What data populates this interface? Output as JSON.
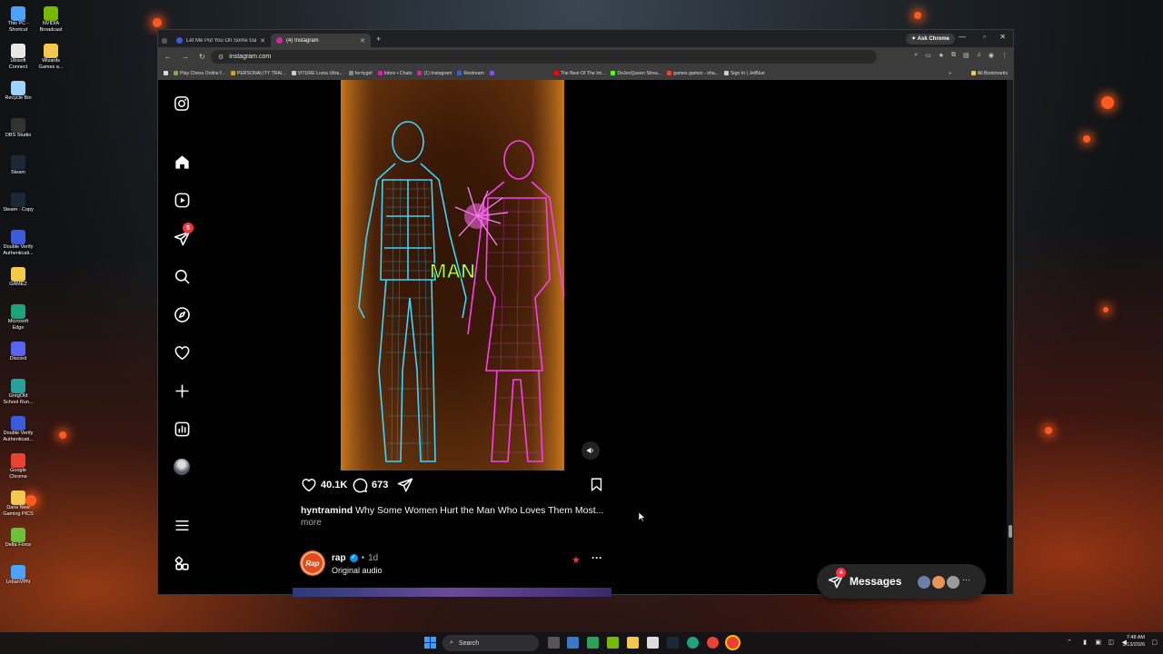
{
  "desktop": {
    "icons_col1": [
      {
        "label": "This PC - Shortcut",
        "icon": "pc-icon",
        "color": "#4aa3ff"
      },
      {
        "label": "Ubisoft Connect",
        "icon": "ubisoft-icon",
        "color": "#e8e8e8"
      },
      {
        "label": "Recycle Bin",
        "icon": "recycle-bin-icon",
        "color": "#9fd3ff"
      },
      {
        "label": "OBS Studio",
        "icon": "obs-icon",
        "color": "#333"
      },
      {
        "label": "Steam",
        "icon": "steam-icon",
        "color": "#1b2838"
      },
      {
        "label": "Steam - Copy",
        "icon": "steam-icon",
        "color": "#1b2838"
      },
      {
        "label": "Double Verify Authenticati...",
        "icon": "authenticator-icon",
        "color": "#3b5bdb"
      },
      {
        "label": "GAMEZ",
        "icon": "folder-icon",
        "color": "#f2c94c"
      },
      {
        "label": "Microsoft Edge",
        "icon": "edge-icon",
        "color": "#1fa37a"
      },
      {
        "label": "Discord",
        "icon": "discord-icon",
        "color": "#5865f2"
      },
      {
        "label": "GregOld School Run...",
        "icon": "game-icon",
        "color": "#2aa198"
      },
      {
        "label": "Double Verify Authenticati...",
        "icon": "authenticator-icon",
        "color": "#3b5bdb"
      },
      {
        "label": "Google Chrome",
        "icon": "chrome-icon",
        "color": "#e94235"
      },
      {
        "label": "Dans New Gaming PICS",
        "icon": "folder-icon",
        "color": "#f2c94c"
      },
      {
        "label": "Delta Force",
        "icon": "game-icon",
        "color": "#6fbf3f"
      },
      {
        "label": "UrbanVPN",
        "icon": "vpn-icon",
        "color": "#4aa3ff"
      }
    ],
    "icons_col2": [
      {
        "label": "NVIDIA Broadcast",
        "icon": "nvidia-icon",
        "color": "#76b900"
      },
      {
        "label": "Wizards Games a...",
        "icon": "folder-icon",
        "color": "#f2c94c"
      }
    ]
  },
  "browser": {
    "tabs": [
      {
        "title": "Let Me Put You On Some Gam...",
        "active": false,
        "favicon_color": "#3b5bdb"
      },
      {
        "title": "(4) Instagram",
        "active": true,
        "favicon_color": "#d6249f"
      }
    ],
    "new_tab": "+",
    "ask_chrome": "Ask Chrome",
    "url": "instagram.com",
    "bookmarks": [
      {
        "label": "Play Chess Online f...",
        "color": "#7fa650"
      },
      {
        "label": "PERSONALITY TRAI...",
        "color": "#c9a227"
      },
      {
        "label": "VITURE Luma Ultra...",
        "color": "#cccccc"
      },
      {
        "label": "ferrtygirl",
        "color": "#888888"
      },
      {
        "label": "Inbox • Chats",
        "color": "#d6249f"
      },
      {
        "label": "(1) Instagram",
        "color": "#d6249f"
      },
      {
        "label": "Restream",
        "color": "#3b5bdb"
      },
      {
        "label": "",
        "color": "#9146ff"
      },
      {
        "label": "The Best Of The Int...",
        "color": "#ff0000"
      },
      {
        "label": "DeJenQueen Strea...",
        "color": "#53fc18"
      },
      {
        "label": "games games - sha...",
        "color": "#ea4335"
      },
      {
        "label": "Sign In | JetBlue",
        "color": "#cccccc"
      }
    ],
    "all_bookmarks": "All Bookmarks"
  },
  "instagram": {
    "nav": [
      {
        "name": "instagram-logo-icon"
      },
      {
        "name": "home-icon"
      },
      {
        "name": "reels-icon"
      },
      {
        "name": "messages-nav-icon"
      },
      {
        "name": "search-icon"
      },
      {
        "name": "explore-icon"
      },
      {
        "name": "notifications-icon"
      },
      {
        "name": "create-icon"
      },
      {
        "name": "dashboard-icon"
      },
      {
        "name": "profile-avatar"
      },
      {
        "name": "menu-icon"
      },
      {
        "name": "more-apps-icon"
      }
    ],
    "messages_badge": "5",
    "post": {
      "overlay_text": "MAN",
      "likes": "40.1K",
      "comments": "673",
      "username": "hyntramind",
      "caption": "Why Some Women Hurt the Man Who Loves Them Most...",
      "more": "more"
    },
    "next_post": {
      "avatar_text": "Rap",
      "username": "rap",
      "time": "1d",
      "sub": "Original audio",
      "separator": "•"
    },
    "messages_button": {
      "label": "Messages",
      "badge": "4",
      "more": "···"
    }
  },
  "taskbar": {
    "search": "Search",
    "time": "7:48 AM",
    "date": "3/13/2026"
  },
  "colors": {
    "accent_pink": "#ff3040",
    "neon_blue": "#39d6ff",
    "neon_magenta": "#ff3cf0",
    "overlay_text": "#c8ff3a"
  }
}
